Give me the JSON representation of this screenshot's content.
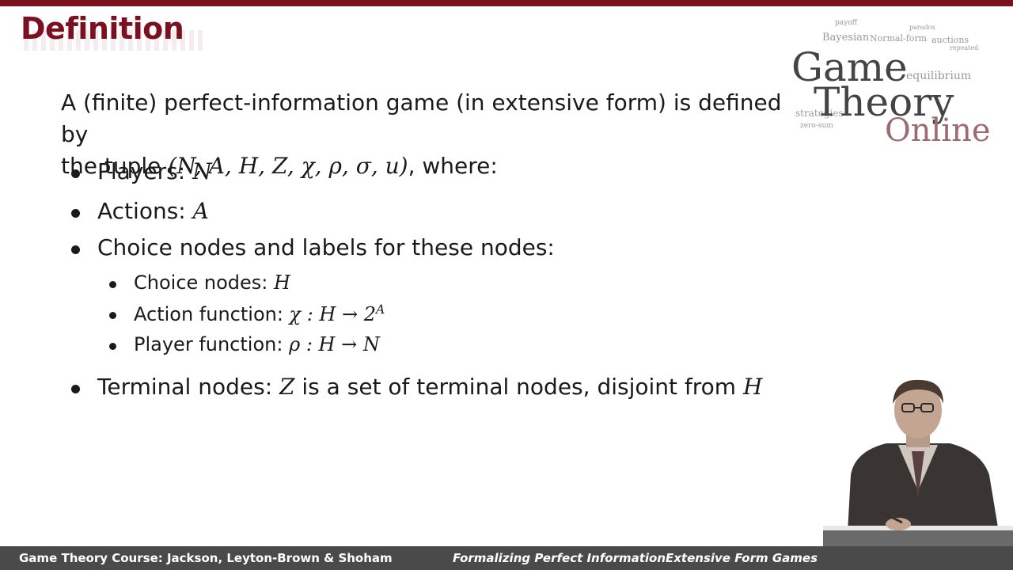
{
  "slide": {
    "title": "Definition",
    "intro_text": "A (finite) perfect-information game (in extensive form) is defined by",
    "intro_text2": "the tuple ",
    "tuple": "(N, A, H, Z, χ, ρ, σ, u)",
    "intro_end": ", where:",
    "items": [
      {
        "label": "Players: ",
        "math": "N"
      },
      {
        "label": "Actions: ",
        "math": "A"
      },
      {
        "label": "Choice nodes and labels for these nodes:"
      },
      {
        "label": "Terminal nodes: ",
        "math": "Z",
        "rest": " is a set of terminal nodes, disjoint from ",
        "math2": "H"
      }
    ],
    "subitems": [
      {
        "label": "Choice nodes: ",
        "math": "H"
      },
      {
        "label": "Action function: ",
        "math": "χ : H → 2",
        "sup": "A"
      },
      {
        "label": "Player function: ",
        "math": "ρ : H → N"
      }
    ]
  },
  "logo": {
    "line1": "Game",
    "line2": "Theory",
    "line3": "Online",
    "cloud_words": [
      "payoff",
      "Bayesian",
      "Normal-form",
      "auctions",
      "equilibrium",
      "strategies",
      "zero-sum",
      "paradox",
      "repeated"
    ]
  },
  "footer": {
    "course": "Game Theory Course: Jackson, Leyton-Brown & Shoham",
    "lecture": "Formalizing Perfect InformationExtensive Form Games"
  },
  "colors": {
    "accent": "#7a1020",
    "footer_bg": "#4a4a4a",
    "text": "#1a1a1a"
  }
}
